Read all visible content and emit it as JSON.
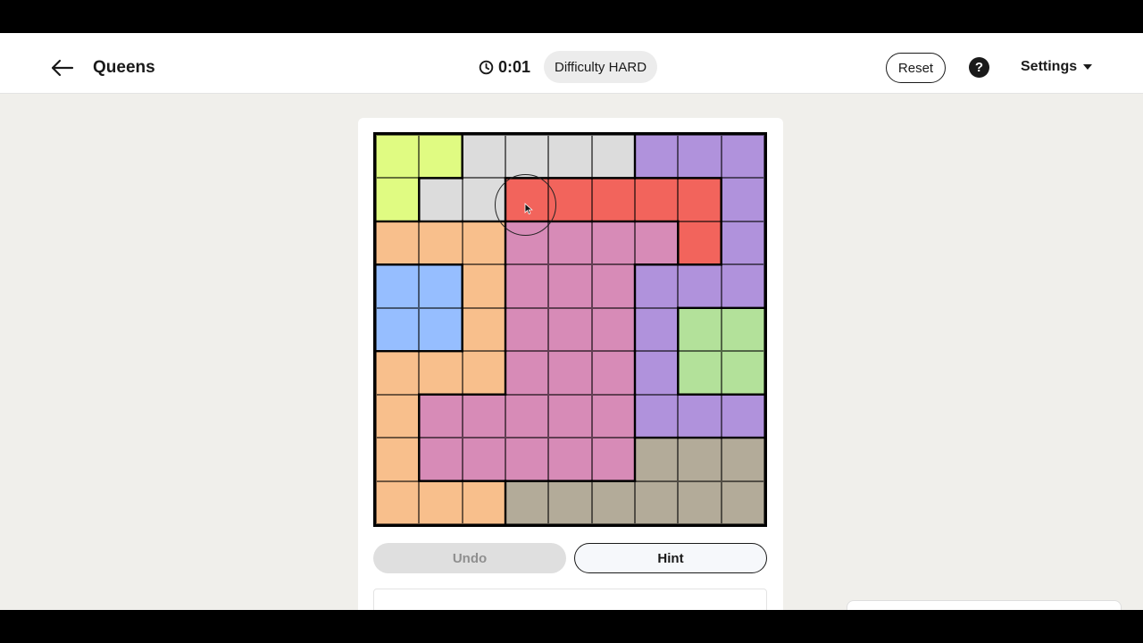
{
  "header": {
    "title": "Queens",
    "timer": "0:01",
    "difficulty": "Difficulty HARD",
    "reset_label": "Reset",
    "help_label": "?",
    "settings_label": "Settings"
  },
  "icons": {
    "back": "arrow-left-icon",
    "timer": "clock-icon",
    "help": "question-icon",
    "settings_caret": "caret-down-icon",
    "cursor": "mouse-pointer-icon"
  },
  "board": {
    "size": 9,
    "colors": {
      "Y": "#e0fb82",
      "G": "#dcdcdc",
      "P": "#b092dc",
      "R": "#f2645c",
      "O": "#f8bf8c",
      "K": "#d78bb7",
      "B": "#96beff",
      "L": "#b3e19a",
      "T": "#b3ab99"
    },
    "regions": [
      "YYGGGGPPP",
      "YGGRRRRRP",
      "OOOKKKKRP",
      "BBOKKKPPP",
      "BBOKKKPLL",
      "OOOKKKPLL",
      "OKKKKKPPP",
      "OKKKKKTTT",
      "OOOTTTTTT"
    ]
  },
  "controls": {
    "undo_label": "Undo",
    "hint_label": "Hint"
  }
}
